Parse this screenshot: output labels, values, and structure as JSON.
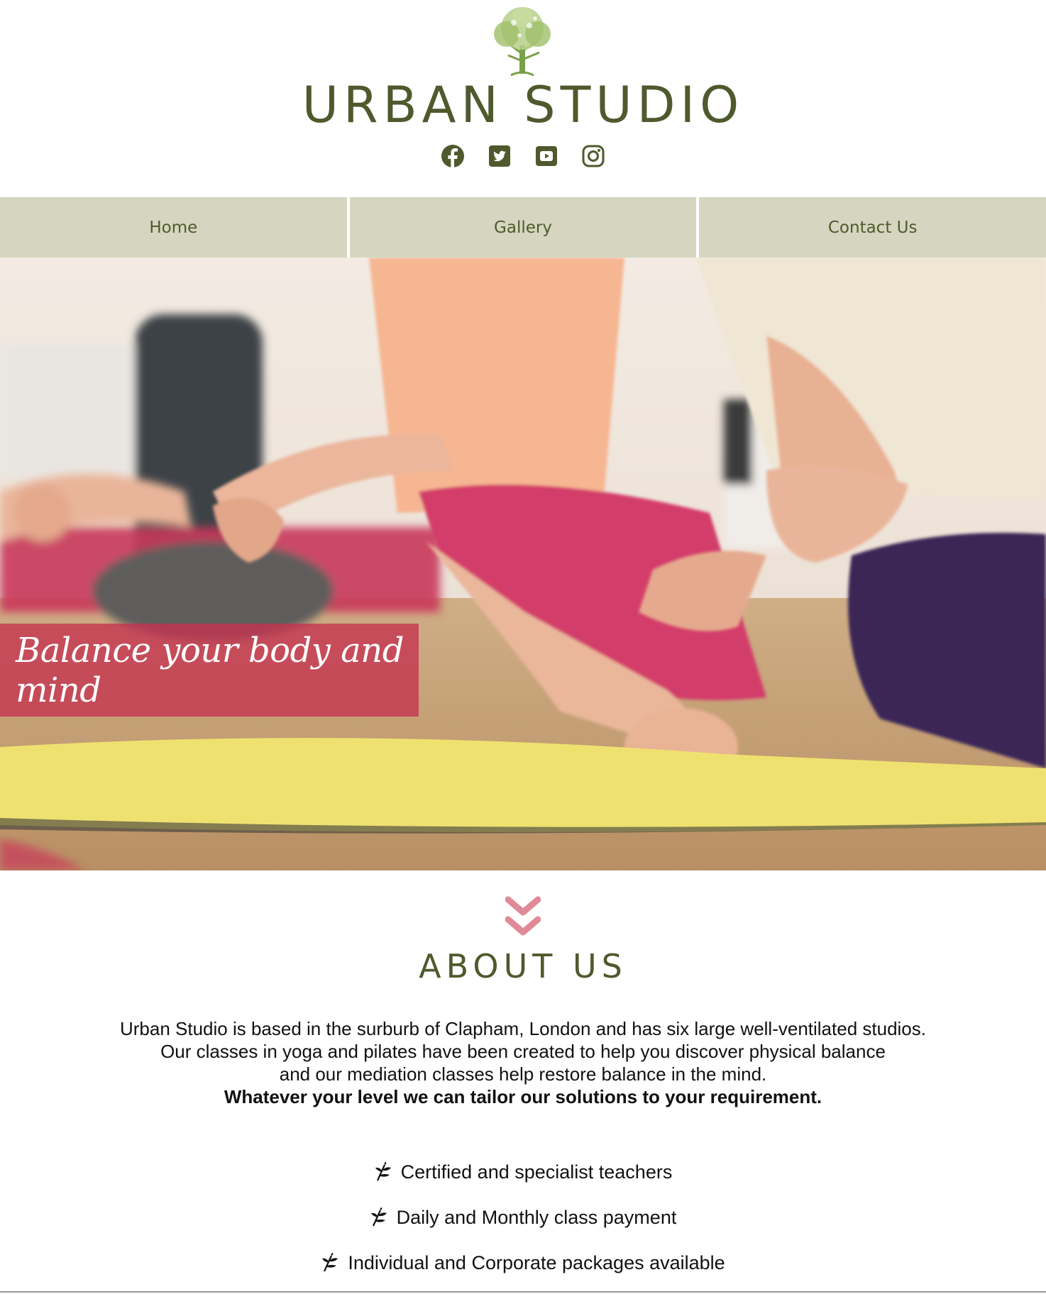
{
  "brand": {
    "name": "URBAN STUDIO"
  },
  "social": [
    "facebook-icon",
    "twitter-icon",
    "youtube-icon",
    "instagram-icon"
  ],
  "nav": {
    "items": [
      {
        "label": "Home"
      },
      {
        "label": "Gallery"
      },
      {
        "label": "Contact Us"
      }
    ]
  },
  "hero": {
    "tagline": "Balance your body and mind"
  },
  "about": {
    "title": "ABOUT US",
    "lines": [
      "Urban Studio is based in the surburb of Clapham, London and has six large well-ventilated studios.",
      "Our classes in yoga and pilates have been created to help you discover physical balance",
      "and our mediation classes help restore balance in the mind."
    ],
    "bold_line": "Whatever your level we can tailor our solutions to your requirement.",
    "features": [
      "Certified and specialist teachers",
      "Daily and Monthly class payment",
      "Individual and Corporate packages available"
    ]
  },
  "colors": {
    "brand_green": "#4e5a2d",
    "nav_bg": "#d6d6c0",
    "accent_pink": "#e08a98",
    "tagline_bg": "#c43250"
  }
}
